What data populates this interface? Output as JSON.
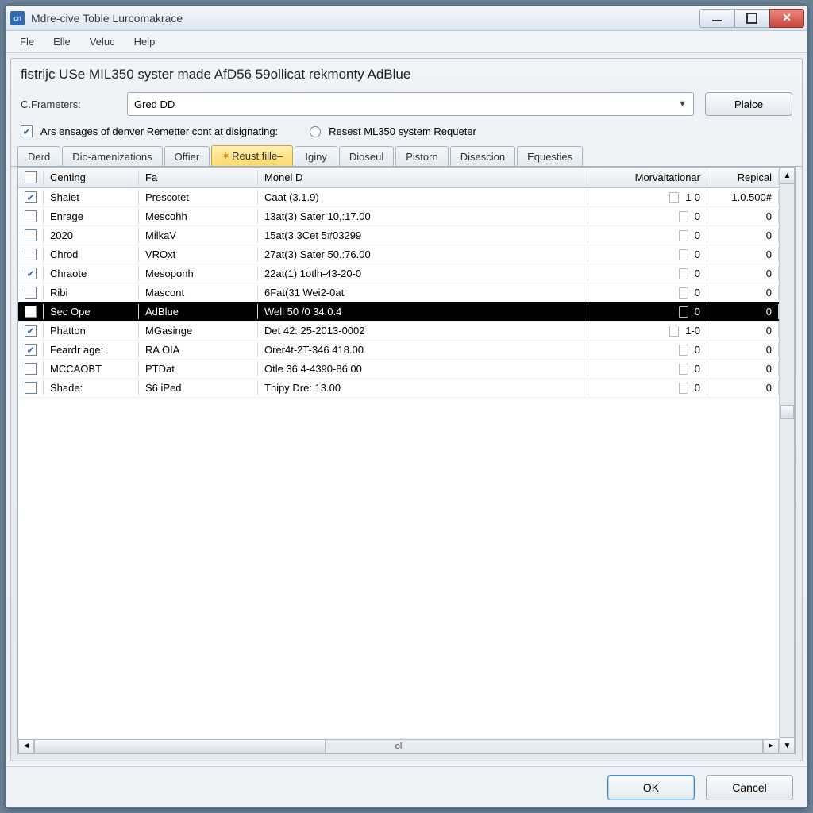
{
  "window": {
    "title": "Mdre-cive Toble Lurcomakrace",
    "icon_text": "cn"
  },
  "menus": [
    "Fle",
    "Elle",
    "Veluc",
    "Help"
  ],
  "heading": "fistrijc USe MIL350 syster made AfD56 59ollicat rekmonty AdBlue",
  "params": {
    "label": "C.Frameters:",
    "value": "Gred DD",
    "place_button": "Plaice"
  },
  "options": {
    "checkbox_label": "Ars ensages of denver Remetter cont at disignating:",
    "checkbox_checked": true,
    "radio_label": "Resest ML350 system Requeter",
    "radio_checked": false
  },
  "tabs": [
    {
      "label": "Derd",
      "active": false
    },
    {
      "label": "Dio-amenizations",
      "active": false
    },
    {
      "label": "Offier",
      "active": false
    },
    {
      "label": "Reust fille–",
      "active": true,
      "star": true
    },
    {
      "label": "Iginy",
      "active": false
    },
    {
      "label": "Dioseul",
      "active": false
    },
    {
      "label": "Pistorn",
      "active": false
    },
    {
      "label": "Disescion",
      "active": false
    },
    {
      "label": "Equesties",
      "active": false
    }
  ],
  "columns": {
    "chk": "",
    "a": "Centing",
    "b": "Fa",
    "c": "Monel D",
    "d": "Morvaitationar",
    "e": "Repical"
  },
  "rows": [
    {
      "chk": true,
      "a": "Shaiet",
      "b": "Prescotet",
      "c": "Caat (3.1.9)",
      "d": "1-0",
      "e": "1.0.500#",
      "sel": false
    },
    {
      "chk": false,
      "a": "Enrage",
      "b": "Mescohh",
      "c": "13at(3) Sater 10,:17.00",
      "d": "0",
      "e": "0",
      "sel": false
    },
    {
      "chk": false,
      "a": "2020",
      "b": "MilkaV",
      "c": "15at(3.3Cet 5#03299",
      "d": "0",
      "e": "0",
      "sel": false
    },
    {
      "chk": false,
      "a": "Chrod",
      "b": "VROxt",
      "c": "27at(3) Sater 50.:76.00",
      "d": "0",
      "e": "0",
      "sel": false
    },
    {
      "chk": true,
      "a": "Chraote",
      "b": "Mesoponh",
      "c": "22at(1) 1otlh-43-20-0",
      "d": "0",
      "e": "0",
      "sel": false
    },
    {
      "chk": false,
      "a": "Ribi",
      "b": "Mascont",
      "c": "6Fat(31 Wei2-0at",
      "d": "0",
      "e": "0",
      "sel": false
    },
    {
      "chk": false,
      "a": "Sec Ope",
      "b": "AdBlue",
      "c": "Well 50 /0 34.0.4",
      "d": "0",
      "e": "0",
      "sel": true
    },
    {
      "chk": true,
      "a": "Phatton",
      "b": "MGasinge",
      "c": "Det 42: 25-2013-0002",
      "d": "1-0",
      "e": "0",
      "sel": false
    },
    {
      "chk": true,
      "a": "Feardr age:",
      "b": "RA OIA",
      "c": "Orer4t-2T-346 418.00",
      "d": "0",
      "e": "0",
      "sel": false
    },
    {
      "chk": false,
      "a": "MCCAOBT",
      "b": "PTDat",
      "c": "Otle 36 4-4390-86.00",
      "d": "0",
      "e": "0",
      "sel": false
    },
    {
      "chk": false,
      "a": "Shade:",
      "b": "S6 iPed",
      "c": "Thipy Dre: 13.00",
      "d": "0",
      "e": "0",
      "sel": false
    }
  ],
  "hscroll_label": "ol",
  "footer": {
    "ok": "OK",
    "cancel": "Cancel"
  }
}
